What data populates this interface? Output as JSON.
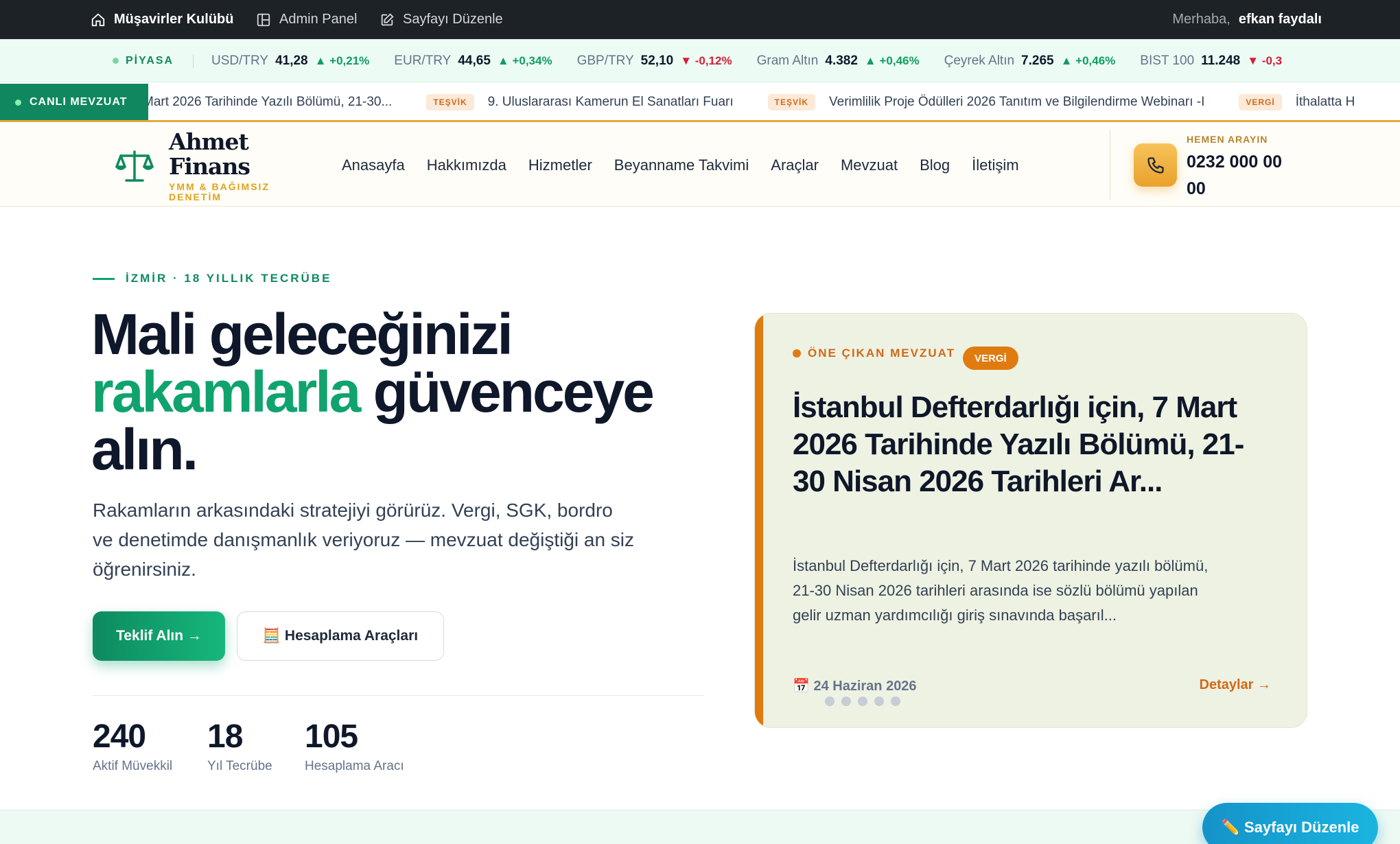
{
  "adminbar": {
    "home_label": "Müşavirler Kulübü",
    "admin_label": "Admin Panel",
    "edit_label": "Sayfayı Düzenle",
    "greeting": "Merhaba,",
    "username": "efkan faydalı"
  },
  "market": {
    "label": "PİYASA",
    "items": [
      {
        "name": "USD/TRY",
        "value": "41,28",
        "change": "▲ +0,21%",
        "dir": "up"
      },
      {
        "name": "EUR/TRY",
        "value": "44,65",
        "change": "▲ +0,34%",
        "dir": "up"
      },
      {
        "name": "GBP/TRY",
        "value": "52,10",
        "change": "▼ -0,12%",
        "dir": "down"
      },
      {
        "name": "Gram Altın",
        "value": "4.382",
        "change": "▲ +0,46%",
        "dir": "up"
      },
      {
        "name": "Çeyrek Altın",
        "value": "7.265",
        "change": "▲ +0,46%",
        "dir": "up"
      },
      {
        "name": "BIST 100",
        "value": "11.248",
        "change": "▼ -0,3",
        "dir": "down"
      }
    ],
    "colors": {
      "up": "#0f9d63",
      "down": "#d61f3a"
    }
  },
  "newsbar": {
    "live_label": "CANLI MEVZUAT",
    "items": [
      {
        "tag": "",
        "text": "Mart 2026 Tarihinde Yazılı Bölümü, 21-30..."
      },
      {
        "tag": "TEŞVİK",
        "text": "9. Uluslararası Kamerun El Sanatları Fuarı"
      },
      {
        "tag": "TEŞVİK",
        "text": "Verimlilik Proje Ödülleri 2026 Tanıtım ve Bilgilendirme Webinarı -I"
      },
      {
        "tag": "VERGİ",
        "text": "İthalatta H"
      }
    ]
  },
  "header": {
    "logo_title": "Ahmet Finans",
    "logo_subtitle": "YMM & BAĞIMSIZ DENETİM",
    "nav": [
      "Anasayfa",
      "Hakkımızda",
      "Hizmetler",
      "Beyanname Takvimi",
      "Araçlar",
      "Mevzuat",
      "Blog",
      "İletişim"
    ],
    "call_label": "HEMEN ARAYIN",
    "phone": "0232 000 00 00"
  },
  "hero": {
    "eyebrow": "İZMİR · 18 YILLIK TECRÜBE",
    "title_line1": "Mali geleceğinizi",
    "title_accent": "rakamlarla",
    "title_rest": " güvenceye alın.",
    "description": "Rakamların arkasındaki stratejiyi görürüz. Vergi, SGK, bordro ve denetimde danışmanlık veriyoruz — mevzuat değiştiği an siz öğrenirsiniz.",
    "primary_button": "Teklif Alın →",
    "secondary_button": "🧮 Hesaplama Araçları",
    "stats": [
      {
        "value": "240",
        "label": "Aktif Müvekkil"
      },
      {
        "value": "18",
        "label": "Yıl Tecrübe"
      },
      {
        "value": "105",
        "label": "Hesaplama Aracı"
      }
    ]
  },
  "featured": {
    "eyebrow": "ÖNE ÇIKAN MEVZUAT",
    "tag": "VERGİ",
    "title": "İstanbul Defterdarlığı için, 7 Mart 2026 Tarihinde Yazılı Bölümü, 21-30 Nisan 2026 Tarihleri Ar...",
    "description": "İstanbul Defterdarlığı için, 7 Mart 2026 tarihinde yazılı bölümü, 21-30 Nisan 2026 tarihleri arasında ise sözlü bölümü yapılan gelir uzman yardımcılığı giriş sınavında başarıl...",
    "date": "📅 24 Haziran 2026",
    "link": "Detaylar →",
    "slide_count": 5
  },
  "floating": {
    "edit_button": "✏️ Sayfayı Düzenle"
  },
  "colors": {
    "brand_green": "#10a36d",
    "accent_orange": "#e07b10",
    "gold": "#e0a21c",
    "adminbar_bg": "#1d2227"
  }
}
